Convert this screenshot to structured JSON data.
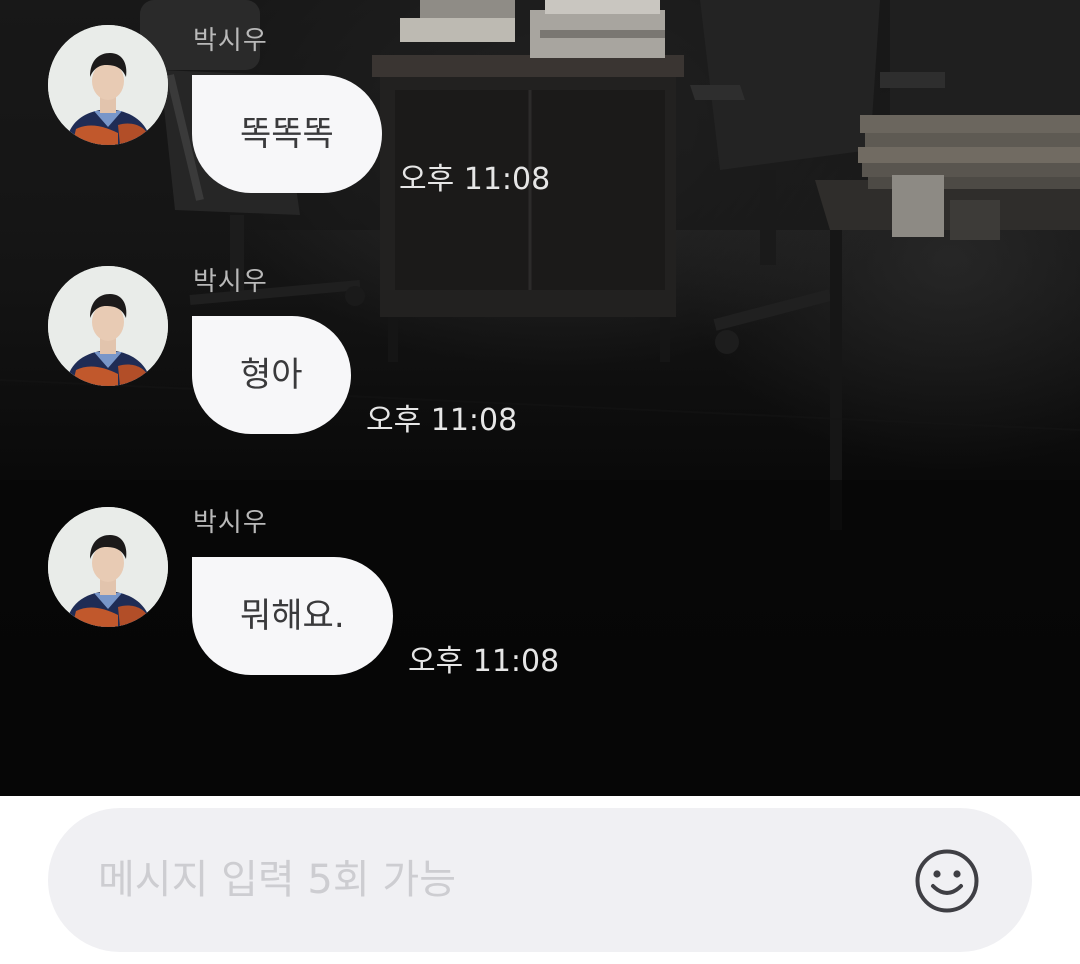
{
  "messages": [
    {
      "sender": "박시우",
      "text": "똑똑똑",
      "time": "오후 11:08"
    },
    {
      "sender": "박시우",
      "text": "형아",
      "time": "오후 11:08"
    },
    {
      "sender": "박시우",
      "text": "뭐해요.",
      "time": "오후 11:08"
    }
  ],
  "composer": {
    "placeholder": "메시지 입력 5회 가능",
    "emoji_icon": "smiley-face-icon"
  },
  "colors": {
    "bubble": "#f7f7f9",
    "bubble_text": "#3a3a3c",
    "timestamp": "#e6e6e6",
    "sender": "#b9b9b9",
    "input_background": "#f0f0f3",
    "placeholder": "#cdcdd1"
  }
}
